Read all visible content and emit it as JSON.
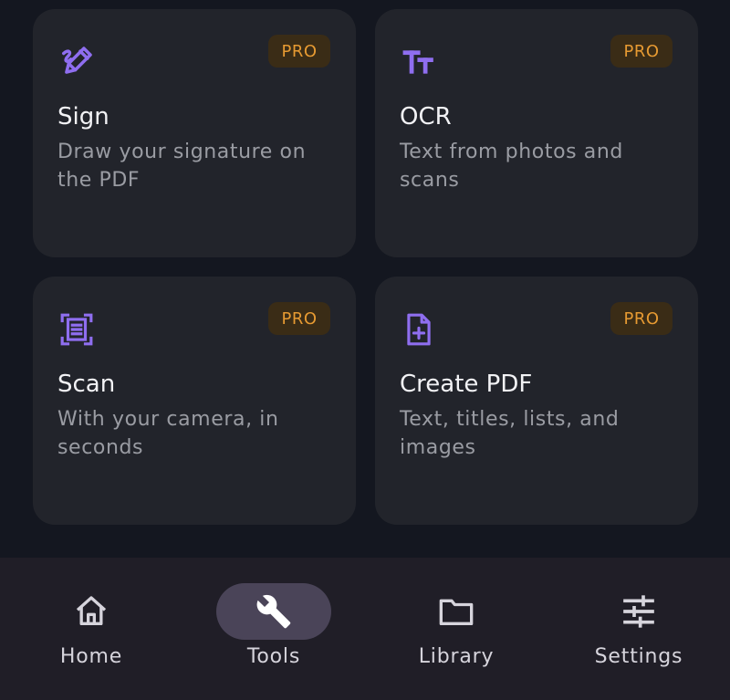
{
  "colors": {
    "background": "#141720",
    "card": "#22242b",
    "icon_accent": "#8f6ef0",
    "badge_bg": "#3a2c16",
    "badge_text": "#e69a32",
    "nav_bg": "#201e27",
    "nav_active_pill": "#4a4458"
  },
  "tools": [
    {
      "icon": "signature-pen-icon",
      "badge": "PRO",
      "title": "Sign",
      "description": "Draw your signature on the PDF"
    },
    {
      "icon": "text-size-icon",
      "badge": "PRO",
      "title": "OCR",
      "description": "Text from photos and scans"
    },
    {
      "icon": "document-scanner-icon",
      "badge": "PRO",
      "title": "Scan",
      "description": "With your camera, in seconds"
    },
    {
      "icon": "note-add-icon",
      "badge": "PRO",
      "title": "Create PDF",
      "description": "Text, titles, lists, and images"
    }
  ],
  "bottom_nav": {
    "active": "Tools",
    "items": [
      {
        "label": "Home",
        "icon": "home-icon"
      },
      {
        "label": "Tools",
        "icon": "wrench-icon"
      },
      {
        "label": "Library",
        "icon": "folder-icon"
      },
      {
        "label": "Settings",
        "icon": "sliders-icon"
      }
    ]
  }
}
